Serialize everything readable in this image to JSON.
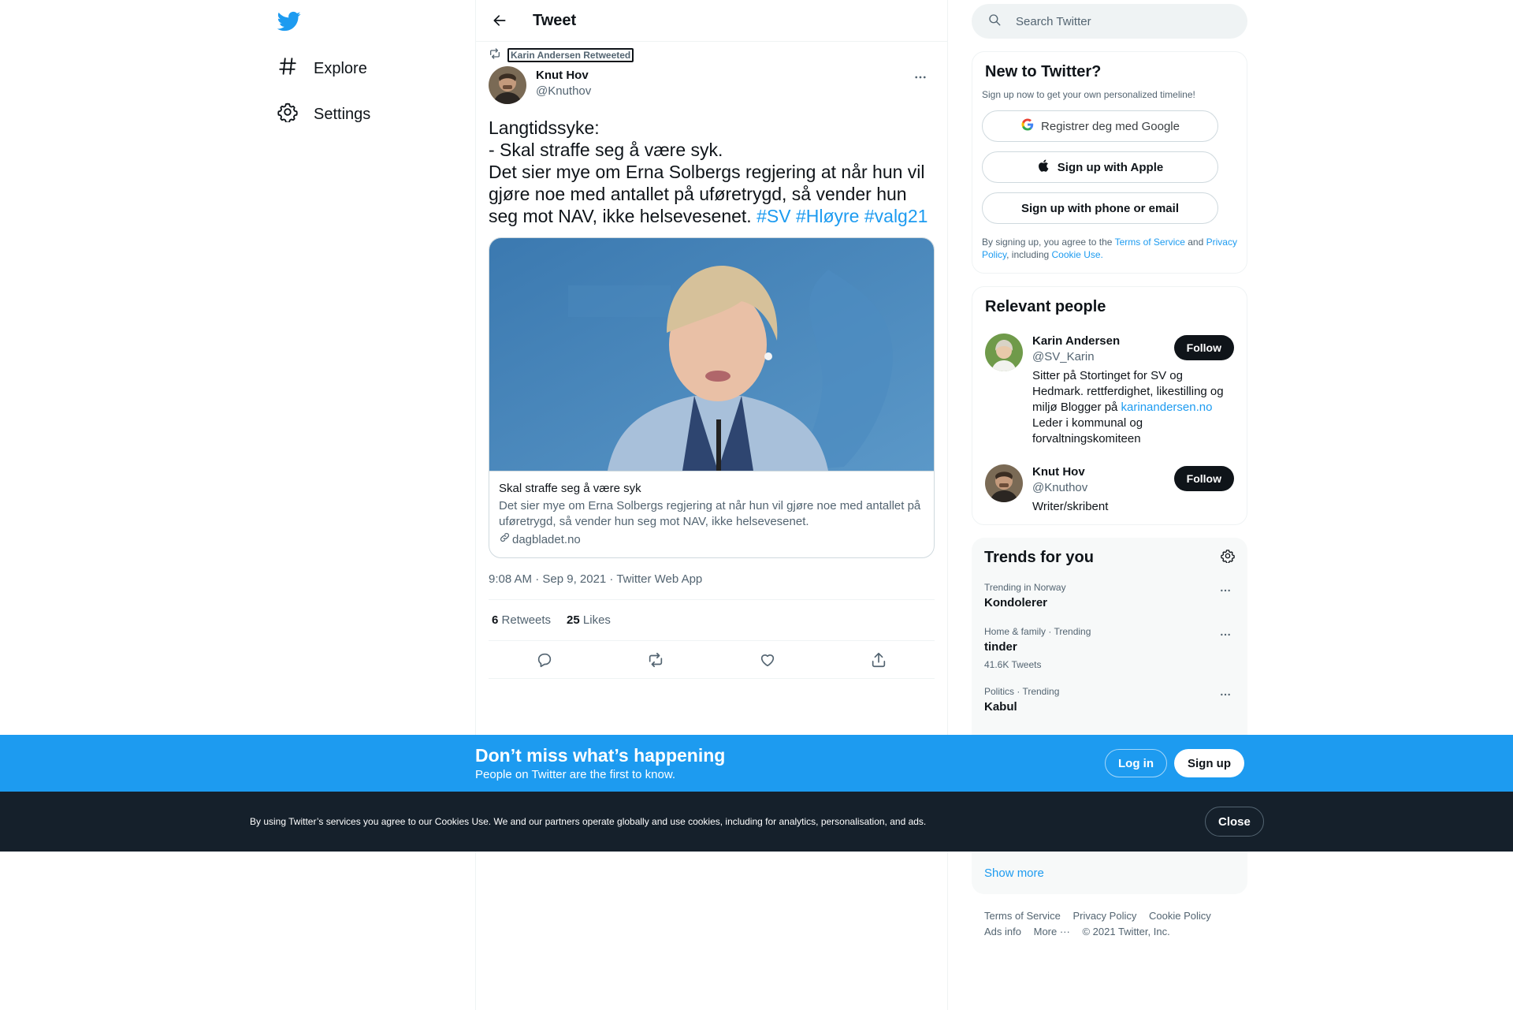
{
  "nav": {
    "logo_icon": "twitter-bird-icon",
    "explore_label": "Explore",
    "settings_label": "Settings"
  },
  "header": {
    "title": "Tweet"
  },
  "tweet": {
    "retweet_label": "Karin Andersen Retweeted",
    "author_name": "Knut Hov",
    "author_handle": "@Knuthov",
    "text_body": "Langtidssyke:\n- Skal straffe seg å være syk.\nDet sier mye om Erna Solbergs regjering at når hun vil gjøre noe med antallet på uføretrygd, så vender hun seg mot NAV, ikke helsevesenet. ",
    "hashtags": [
      "#SV",
      "#Hløyre",
      "#valg21"
    ],
    "card": {
      "title": "Skal straffe seg å være syk",
      "description": "Det sier mye om Erna Solbergs regjering at når hun vil gjøre noe med antallet på uføretrygd, så vender hun seg mot NAV, ikke helsevesenet.",
      "domain": "dagbladet.no"
    },
    "timestamp": "9:08 AM · Sep 9, 2021 · Twitter Web App",
    "retweets_count": "6",
    "retweets_label": "Retweets",
    "likes_count": "25",
    "likes_label": "Likes"
  },
  "sidebar": {
    "search_placeholder": "Search Twitter",
    "new_to_twitter": {
      "title": "New to Twitter?",
      "subtitle": "Sign up now to get your own personalized timeline!",
      "google_label": "Registrer deg med Google",
      "apple_label": "Sign up with Apple",
      "phone_label": "Sign up with phone or email",
      "legal_prefix": "By signing up, you agree to the ",
      "terms_link": "Terms of Service",
      "legal_and": " and ",
      "privacy_link": "Privacy Policy",
      "legal_including": ", including ",
      "cookie_link": "Cookie Use."
    },
    "relevant_people": {
      "title": "Relevant people",
      "people": [
        {
          "name": "Karin Andersen",
          "handle": "@SV_Karin",
          "bio_prefix": "Sitter på Stortinget for SV og Hedmark. rettferdighet, likestilling og miljø Blogger på ",
          "bio_link": "karinandersen.no",
          "bio_suffix": " Leder i kommunal og forvaltningskomiteen",
          "follow_label": "Follow"
        },
        {
          "name": "Knut Hov",
          "handle": "@Knuthov",
          "bio_prefix": "Writer/skribent",
          "follow_label": "Follow"
        }
      ]
    },
    "trends": {
      "title": "Trends for you",
      "items": [
        {
          "meta": "Trending in Norway",
          "name": "Kondolerer",
          "count": ""
        },
        {
          "meta": "Home & family · Trending",
          "name": "tinder",
          "count": "41.6K Tweets"
        },
        {
          "meta": "Politics · Trending",
          "name": "Kabul",
          "count": ""
        }
      ],
      "show_more": "Show more"
    },
    "footer": {
      "terms": "Terms of Service",
      "privacy": "Privacy Policy",
      "cookie": "Cookie Policy",
      "ads": "Ads info",
      "more": "More ···",
      "copyright": "© 2021 Twitter, Inc."
    }
  },
  "bottom_bar": {
    "title": "Don’t miss what’s happening",
    "subtitle": "People on Twitter are the first to know.",
    "login_label": "Log in",
    "signup_label": "Sign up"
  },
  "cookie_bar": {
    "text": "By using Twitter’s services you agree to our Cookies Use. We and our partners operate globally and use cookies, including for analytics, personalisation, and ads.",
    "close_label": "Close"
  },
  "colors": {
    "accent": "#1d9bf0",
    "text_primary": "#0f1419",
    "text_secondary": "#536471",
    "cookie_bar_bg": "#15202b"
  }
}
